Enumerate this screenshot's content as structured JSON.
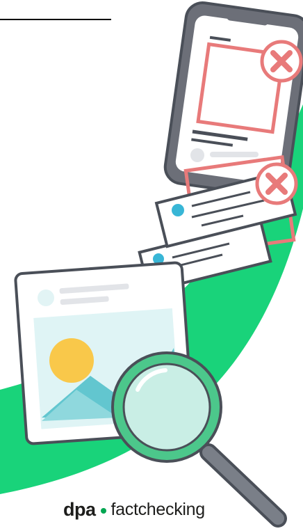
{
  "brand": {
    "name": "dpa",
    "product": "factchecking",
    "accent_color": "#00a651"
  },
  "illustration": {
    "icons": [
      "smartphone",
      "reject-x-icon",
      "message-card",
      "photo-card",
      "magnifying-glass-icon"
    ],
    "colors": {
      "green_band": "#19d37a",
      "outline": "#4a4f58",
      "phone_body": "#6c6f78",
      "reject_red": "#e87a7a",
      "card_blue": "#38b6d6",
      "sun_yellow": "#f9c84a",
      "mountain_teal": "#62c6cf",
      "lens_green": "#4cc78b"
    }
  }
}
